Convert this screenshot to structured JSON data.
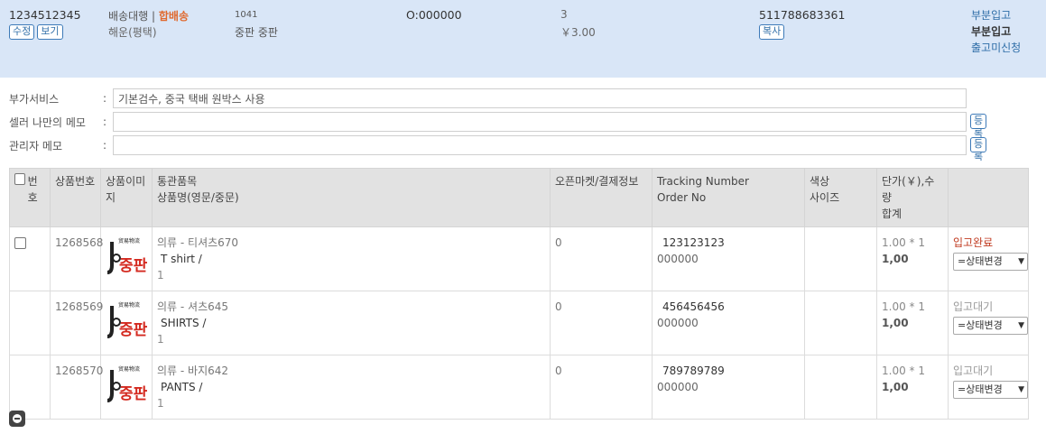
{
  "header": {
    "order_id": "1234512345",
    "edit_label": "수정",
    "view_label": "보기",
    "ship_agency": "배송대행",
    "ship_sep": "|",
    "ship_merge": "합배송",
    "ship_method": "해운(평택)",
    "center_code": "1041",
    "center_name": "중판 중판",
    "o_number": "O:000000",
    "qty": "3",
    "price": "￥3.00",
    "tracking": "511788683361",
    "copy_label": "복사",
    "status_link": "부분입고",
    "status_bold": "부분입고",
    "status_link2": "출고미신청"
  },
  "memos": {
    "service_label": "부가서비스",
    "service_value": "기본검수, 중국 택배 원박스 사용",
    "seller_label": "셀러 나만의 메모",
    "seller_value": "",
    "admin_label": "관리자 메모",
    "admin_value": "",
    "colon": ":",
    "register_label": "등록"
  },
  "table": {
    "headers": {
      "no": "번호",
      "product_no": "상품번호",
      "image": "상품이미지",
      "customs_line1": "통관품목",
      "customs_line2": "상품명(영문/중문)",
      "market": "오픈마켓/결제정보",
      "tracking_line1": "Tracking Number",
      "tracking_line2": "Order No",
      "color_line1": "색상",
      "color_line2": "사이즈",
      "price_line1": "단가(￥),수량",
      "price_line2": "합계"
    },
    "rows": [
      {
        "product_no": "1268568",
        "category": "의류 - 티셔츠670",
        "name": "T shirt /",
        "qty": "1",
        "market": "0",
        "tracking": "123123123",
        "order_no": "000000",
        "unit": "1.00 * 1",
        "total": "1,00",
        "status": "입고완료",
        "select_value": "=상태변경"
      },
      {
        "product_no": "1268569",
        "category": "의류 - 셔츠645",
        "name": "SHIRTS /",
        "qty": "1",
        "market": "0",
        "tracking": "456456456",
        "order_no": "000000",
        "unit": "1.00 * 1",
        "total": "1,00",
        "status": "입고대기",
        "select_value": "=상태변경"
      },
      {
        "product_no": "1268570",
        "category": "의류 - 바지642",
        "name": "PANTS /",
        "qty": "1",
        "market": "0",
        "tracking": "789789789",
        "order_no": "000000",
        "unit": "1.00 * 1",
        "total": "1,00",
        "status": "입고대기",
        "select_value": "=상태변경"
      }
    ],
    "thumb_logo_text": "중판",
    "thumb_small_text": "贸易物流"
  },
  "icons": {
    "collapse": "minus-circle-icon",
    "dropdown": "chevron-down-icon"
  },
  "colors": {
    "header_bg": "#d9e6f7",
    "link": "#2f6ea8",
    "merge": "#e0692e",
    "status_done": "#c03a20"
  }
}
